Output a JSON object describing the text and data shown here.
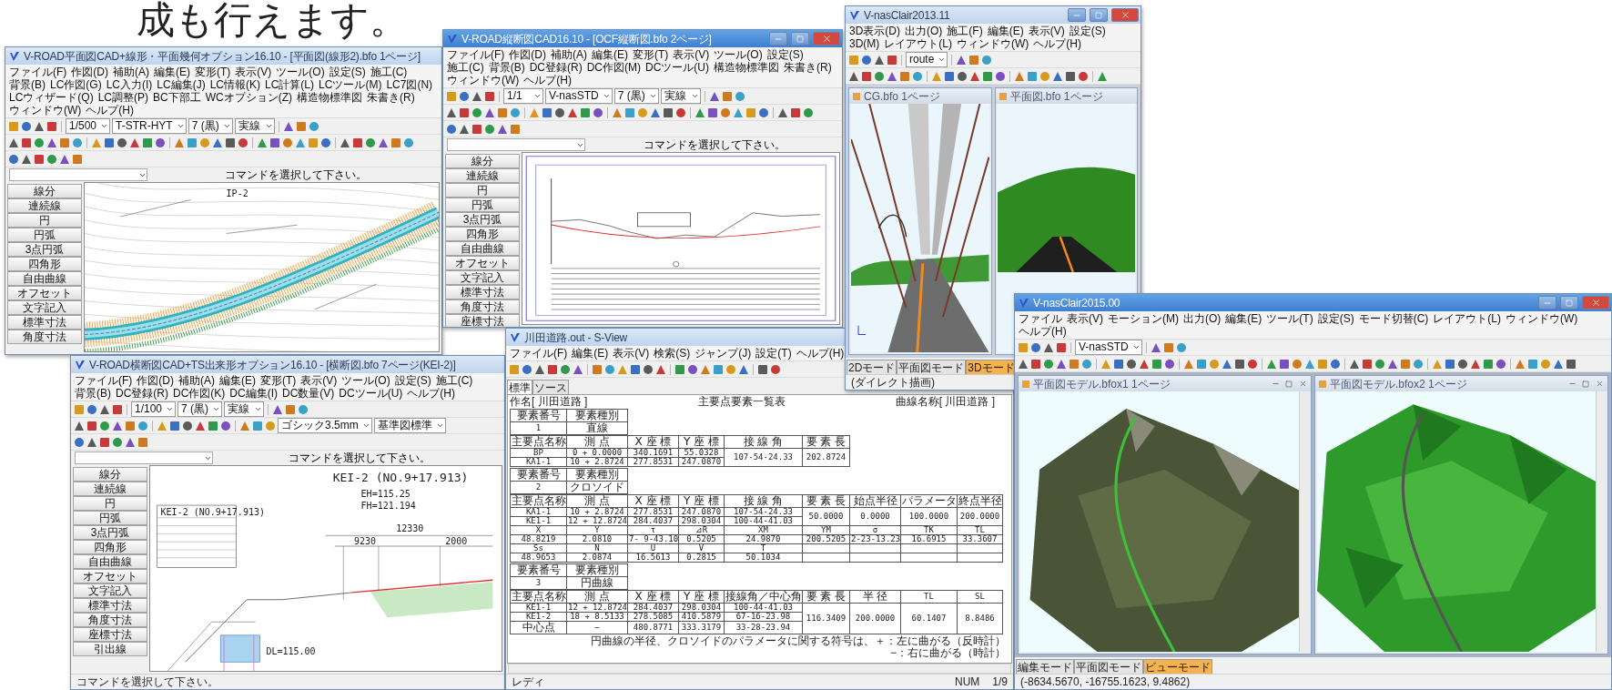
{
  "caption": "成も行えます。",
  "windows": [
    {
      "kind": "plan",
      "title": "V-ROAD平面図CAD+線形・平面幾何オプション16.10 - [平面図(線形2).bfo 1ページ]",
      "active": false,
      "controls": false,
      "menus": [
        "ファイル(F)",
        "作図(D)",
        "補助(A)",
        "編集(E)",
        "変形(T)",
        "表示(V)",
        "ツール(O)",
        "設定(S)",
        "施工(C)",
        "背景(B)",
        "LC作図(G)",
        "LC入力(I)",
        "LC編集(J)",
        "LC情報(K)",
        "LC計算(L)",
        "LCツール(M)",
        "LC7図(N)",
        "LCウィザード(Q)",
        "LC調整(P)",
        "BC下部工",
        "WCオプション(Z)",
        "構造物標準図",
        "朱書き(R)",
        "ウィンドウ(W)",
        "ヘルプ(H)"
      ],
      "combos": [
        "1/500",
        "T-STR-HYT",
        "7 (黒)",
        "実線"
      ],
      "command": "コマンドを選択して下さい。",
      "palette": [
        "線分",
        "連続線",
        "円",
        "円弧",
        "3点円弧",
        "四角形",
        "自由曲線",
        "オフセット",
        "文字記入",
        "標準寸法",
        "角度寸法"
      ],
      "labels": [
        "IP-2"
      ]
    },
    {
      "kind": "profile",
      "title": "V-ROAD縦断図CAD16.10 - [OCF縦断図.bfo 2ページ]",
      "active": true,
      "controls": true,
      "menus": [
        "ファイル(F)",
        "作図(D)",
        "補助(A)",
        "編集(E)",
        "変形(T)",
        "表示(V)",
        "ツール(O)",
        "設定(S)",
        "施工(C)",
        "背景(B)",
        "DC登録(R)",
        "DC作図(M)",
        "DCツール(U)",
        "構造物標準図",
        "朱書き(R)",
        "ウィンドウ(W)",
        "ヘルプ(H)"
      ],
      "combos": [
        "1/1",
        "V-nasSTD",
        "7 (黒)",
        "実線"
      ],
      "command": "コマンドを選択して下さい。",
      "palette": [
        "線分",
        "連続線",
        "円",
        "円弧",
        "3点円弧",
        "四角形",
        "自由曲線",
        "オフセット",
        "文字記入",
        "標準寸法",
        "角度寸法",
        "座標寸法"
      ]
    },
    {
      "kind": "viewer",
      "title": "V-nasClair2013.11",
      "active": false,
      "controls": true,
      "menus": [
        "3D表示(D)",
        "出力(O)",
        "施工(F)",
        "編集(E)",
        "表示(V)",
        "設定(S)",
        "3D(M)",
        "レイアウト(L)",
        "ウィンドウ(W)",
        "ヘルプ(H)"
      ],
      "combos": [
        "route"
      ],
      "panes": [
        {
          "kind": "bridge",
          "title": "CG.bfo 1ページ"
        },
        {
          "kind": "road",
          "title": "平面図.bfo 1ページ"
        }
      ],
      "tabs": [
        {
          "label": "2Dモード",
          "selected": false
        },
        {
          "label": "平面図モード",
          "selected": false
        },
        {
          "label": "3Dモード",
          "selected": true
        }
      ],
      "status": [
        "(ダイレクト描画)"
      ]
    },
    {
      "kind": "cross",
      "title": "V-ROAD横断図CAD+TS出来形オプション16.10 - [横断図.bfo 7ページ(KEI-2)]",
      "active": false,
      "controls": false,
      "menus": [
        "ファイル(F)",
        "作図(D)",
        "補助(A)",
        "編集(E)",
        "変形(T)",
        "表示(V)",
        "ツール(O)",
        "設定(S)",
        "施工(C)",
        "背景(B)",
        "DC登録(R)",
        "DC作図(K)",
        "DC編集(I)",
        "DC数量(V)",
        "DCツール(U)",
        "ヘルプ(H)"
      ],
      "combos": [
        "1/100",
        "7 (黒)",
        "実線"
      ],
      "combos2": [
        "ゴシック3.5mm",
        "基準図標準"
      ],
      "command": "コマンドを選択して下さい。",
      "palette": [
        "線分",
        "連続線",
        "円",
        "円弧",
        "3点円弧",
        "四角形",
        "自由曲線",
        "オフセット",
        "文字記入",
        "標準寸法",
        "角度寸法",
        "座標寸法",
        "引出線"
      ],
      "sheet": {
        "title": "KEI-2 (NO.9+17.913)",
        "levels": [
          "EH=115.25",
          "FH=121.194"
        ],
        "box_title": "KEI-2 (NO.9+17.913)",
        "dims": [
          "12330",
          "9230",
          "2000"
        ],
        "dl": "DL=115.00"
      },
      "status": [
        "コマンドを選択して下さい。"
      ]
    },
    {
      "kind": "report",
      "title": "川田道路.out - S-View",
      "active": false,
      "controls": false,
      "menus": [
        "ファイル(F)",
        "編集(E)",
        "表示(V)",
        "検索(S)",
        "ジャンプ(J)",
        "設定(T)",
        "ヘルプ(H)"
      ],
      "tabs": [
        {
          "label": "標準",
          "selected": true
        },
        {
          "label": "ソース",
          "selected": false
        }
      ],
      "report": {
        "job": "作名[ 川田道路 ]",
        "heading": "主要点要素一覧表",
        "curve": "曲線名称[ 川田道路 ]",
        "tables": [
          {
            "kind_rows": [
              [
                "要素番号",
                "要素種別"
              ],
              [
                "1",
                "直線"
              ]
            ],
            "rows": [
              [
                "主要点名称",
                "測 点",
                "X 座 標",
                "Y 座 標",
                "接 線 角",
                "要 素 長"
              ],
              [
                "BP",
                "0 + 0.0000",
                "340.1691",
                "55.0328",
                {
                  "text": "107-54-24.33",
                  "rowspan": 2
                },
                {
                  "text": "202.8724",
                  "rowspan": 2
                }
              ],
              [
                "KA1-1",
                "10 + 2.8724",
                "277.8531",
                "247.0870"
              ]
            ]
          },
          {
            "kind_rows": [
              [
                "要素番号",
                "要素種別"
              ],
              [
                "2",
                "クロソイド"
              ]
            ],
            "rows": [
              [
                "主要点名称",
                "測 点",
                "X 座 標",
                "Y 座 標",
                "接 線 角",
                "要 素 長",
                "始点半径",
                "パラメータ",
                "終点半径"
              ],
              [
                "KA1-1",
                "10 + 2.8724",
                "277.8531",
                "247.0870",
                "107-54-24.33",
                {
                  "text": "50.0000",
                  "rowspan": 2
                },
                {
                  "text": "0.0000",
                  "rowspan": 2
                },
                {
                  "text": "100.0000",
                  "rowspan": 2
                },
                {
                  "text": "200.0000",
                  "rowspan": 2
                }
              ],
              [
                "KE1-1",
                "12 + 12.8724",
                "284.4037",
                "298.0304",
                "100-44-41.03"
              ],
              [
                "X",
                "Y",
                "τ",
                "⊿R",
                "XM",
                "YM",
                "σ",
                "TK",
                "TL"
              ],
              [
                "48.8219",
                "2.0810",
                "7- 9-43.10",
                "0.5205",
                "24.9870",
                "200.5205",
                "2-23-13.23",
                "16.6915",
                "33.3607"
              ],
              [
                "Ss",
                "N",
                "U",
                "V",
                "T"
              ],
              [
                "48.9653",
                "2.0874",
                "16.5613",
                "0.2815",
                "50.1034"
              ]
            ]
          },
          {
            "kind_rows": [
              [
                "要素番号",
                "要素種別"
              ],
              [
                "3",
                "円曲線"
              ]
            ],
            "rows": [
              [
                "主要点名称",
                "測 点",
                "X 座 標",
                "Y 座 標",
                "接線角／中心角",
                "要 素 長",
                "半 径",
                "TL",
                "SL"
              ],
              [
                "KE1-1",
                "12 + 12.8724",
                "284.4037",
                "298.0304",
                "100-44-41.03",
                {
                  "text": "116.3409",
                  "rowspan": 3
                },
                {
                  "text": "200.0000",
                  "rowspan": 3
                },
                {
                  "text": "60.1407",
                  "rowspan": 3
                },
                {
                  "text": "8.8486",
                  "rowspan": 3
                }
              ],
              [
                "KE1-2",
                "18 + 8.5133",
                "278.5085",
                "410.5879",
                "67-16-23.98"
              ],
              [
                "中心点",
                "−",
                "480.8771",
                "333.3179",
                "33-28-23.94"
              ]
            ]
          }
        ],
        "note": [
          "円曲線の半径、クロソイドのパラメータに関する符号は、＋：左に曲がる（反時計）",
          "−：右に曲がる（時計）"
        ]
      },
      "status": [
        "レディ",
        "NUM",
        "1/9"
      ]
    },
    {
      "kind": "viewer",
      "title": "V-nasClair2015.00",
      "active": true,
      "controls": true,
      "menus": [
        "ファイル",
        "表示(V)",
        "モーション(M)",
        "出力(O)",
        "編集(E)",
        "ツール(T)",
        "設定(S)",
        "モード切替(C)",
        "レイアウト(L)",
        "ウィンドウ(W)",
        "ヘルプ(H)"
      ],
      "combos": [
        "V-nasSTD"
      ],
      "panes": [
        {
          "kind": "aerial",
          "title": "平面図モデル.bfox1 1ページ"
        },
        {
          "kind": "terrain",
          "title": "平面図モデル.bfox2 1ページ"
        }
      ],
      "tabs": [
        {
          "label": "編集モード",
          "selected": false
        },
        {
          "label": "平面図モード",
          "selected": false
        },
        {
          "label": "ビューモード",
          "selected": true
        }
      ],
      "status": [
        "(-8634.5670, -16755.1623, 9.4862)"
      ]
    }
  ]
}
